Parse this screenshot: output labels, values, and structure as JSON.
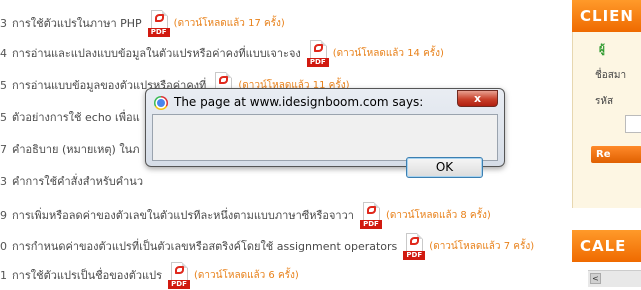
{
  "list": {
    "items": [
      {
        "num": "3",
        "title": "การใช้ตัวแปรในภาษา PHP",
        "downloads": "(ดาวน์โหลดแล้ว 17 ครั้ง)"
      },
      {
        "num": "4",
        "title": "การอ่านและแปลงแบบข้อมูลในตัวแปรหรือค่าคงที่แบบเจาะจง",
        "downloads": "(ดาวน์โหลดแล้ว 14 ครั้ง)"
      },
      {
        "num": "5",
        "title": "การอ่านแบบข้อมูลของตัวแปรหรือค่าคงที่",
        "downloads": "(ดาวน์โหลดแล้ว 11 ครั้ง)"
      },
      {
        "num": "5",
        "title": "ตัวอย่างการใช้ echo เพื่อแ",
        "downloads": ""
      },
      {
        "num": "7",
        "title": "คำอธิบาย (หมายเหตุ) ในภ",
        "downloads": ""
      },
      {
        "num": "3",
        "title": "คำการใช้คำสั่งสำหรับคำนว",
        "downloads": ""
      },
      {
        "num": "9",
        "title": "การเพิ่มหรือลดค่าของตัวเลขในตัวแปรทีละหนึ่งตามแบบภาษาซีหรือจาวา",
        "downloads": "(ดาวน์โหลดแล้ว 8 ครั้ง)"
      },
      {
        "num": "0",
        "title": "การกำหนดค่าของตัวแปรที่เป็นตัวเลขหรือสตริงค์โดยใช้ assignment operators",
        "downloads": "(ดาวน์โหลดแล้ว 7 ครั้ง)"
      },
      {
        "num": "1",
        "title": "การใช้ตัวแปรเป็นชื่อของตัวแปร",
        "downloads": "(ดาวน์โหลดแล้ว 6 ครั้ง)"
      }
    ],
    "pdf_label": "PDF"
  },
  "sidebar": {
    "client_title": "CLIEN",
    "login_label": "ผู้",
    "username_label": "ชื่อสมา",
    "password_label": "รหัส",
    "button_label": "Re",
    "calendar_title": "CALE",
    "prev_label": "<"
  },
  "dialog": {
    "title": "The page at www.idesignboom.com says:",
    "message": "",
    "ok_label": "OK",
    "close_label": "x"
  },
  "colors": {
    "accent_orange": "#ef6a00",
    "download_text": "#e8811a",
    "pdf_red": "#d11a10"
  }
}
